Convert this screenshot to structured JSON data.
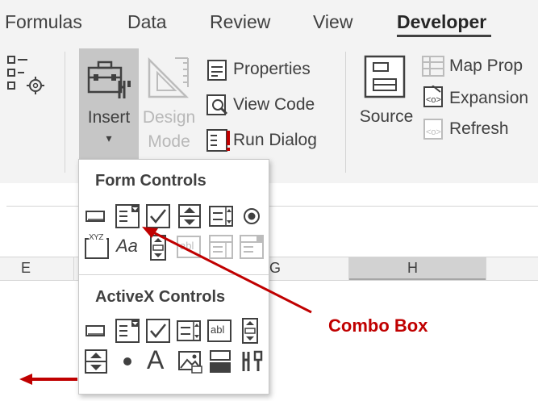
{
  "tabs": [
    {
      "label": "Formulas",
      "active": false
    },
    {
      "label": "Data",
      "active": false
    },
    {
      "label": "Review",
      "active": false
    },
    {
      "label": "View",
      "active": false
    },
    {
      "label": "Developer",
      "active": true
    }
  ],
  "ribbon": {
    "insert": {
      "label": "Insert",
      "icon": "toolbox-icon",
      "dropdown_glyph": "▾"
    },
    "design_mode": {
      "line1": "Design",
      "line2": "Mode",
      "icon": "design-mode-icon",
      "enabled": false
    },
    "properties": {
      "label": "Properties",
      "icon": "properties-icon"
    },
    "view_code": {
      "label": "View Code",
      "icon": "view-code-icon"
    },
    "run_dialog": {
      "label": "Run Dialog",
      "icon": "run-dialog-icon"
    },
    "source": {
      "label": "Source",
      "icon": "xml-source-icon"
    },
    "map_prop": {
      "label": "Map Prop",
      "icon": "map-properties-icon",
      "enabled": false
    },
    "expansion": {
      "label": "Expansion",
      "icon": "expansion-packs-icon"
    },
    "refresh": {
      "label": "Refresh",
      "icon": "refresh-data-icon",
      "enabled": false
    }
  },
  "columns": [
    "E",
    "G",
    "H"
  ],
  "insert_dropdown": {
    "form_controls_title": "Form Controls",
    "form_controls": [
      {
        "name": "button",
        "icon": "button-icon"
      },
      {
        "name": "combo-box",
        "icon": "combo-box-icon"
      },
      {
        "name": "check-box",
        "icon": "check-box-icon"
      },
      {
        "name": "spin-button",
        "icon": "spin-button-icon"
      },
      {
        "name": "list-box",
        "icon": "list-box-icon"
      },
      {
        "name": "option-button",
        "icon": "option-button-icon"
      },
      {
        "name": "group-box",
        "icon": "group-box-icon",
        "text": "XYZ"
      },
      {
        "name": "label",
        "icon": "label-icon",
        "text": "Aa"
      },
      {
        "name": "scroll-bar",
        "icon": "scroll-bar-icon"
      },
      {
        "name": "text-field",
        "icon": "text-field-icon",
        "text": "abl",
        "enabled": false
      },
      {
        "name": "combo-list-edit",
        "icon": "combo-list-edit-icon",
        "enabled": false
      },
      {
        "name": "combo-drop-down-edit",
        "icon": "combo-drop-down-edit-icon",
        "enabled": false
      }
    ],
    "activex_controls_title": "ActiveX Controls",
    "activex_controls": [
      {
        "name": "command-button",
        "icon": "command-button-icon"
      },
      {
        "name": "combo-box",
        "icon": "combo-box-icon"
      },
      {
        "name": "check-box",
        "icon": "check-box-icon"
      },
      {
        "name": "list-box",
        "icon": "list-box-icon"
      },
      {
        "name": "text-box",
        "icon": "text-box-icon",
        "text": "abl"
      },
      {
        "name": "scroll-bar",
        "icon": "scroll-bar-icon"
      },
      {
        "name": "spin-button",
        "icon": "spin-button-icon"
      },
      {
        "name": "option-button",
        "icon": "option-button-icon"
      },
      {
        "name": "label",
        "icon": "label-icon",
        "text": "A"
      },
      {
        "name": "image",
        "icon": "image-icon"
      },
      {
        "name": "toggle-button",
        "icon": "toggle-button-icon"
      },
      {
        "name": "more-controls",
        "icon": "more-controls-icon"
      }
    ]
  },
  "annotation": {
    "label": "Combo Box",
    "color": "#c00000"
  },
  "colors": {
    "accent_red": "#c00000",
    "ribbon_bg": "#f3f3f3",
    "selected_bg": "#c6c6c6"
  }
}
